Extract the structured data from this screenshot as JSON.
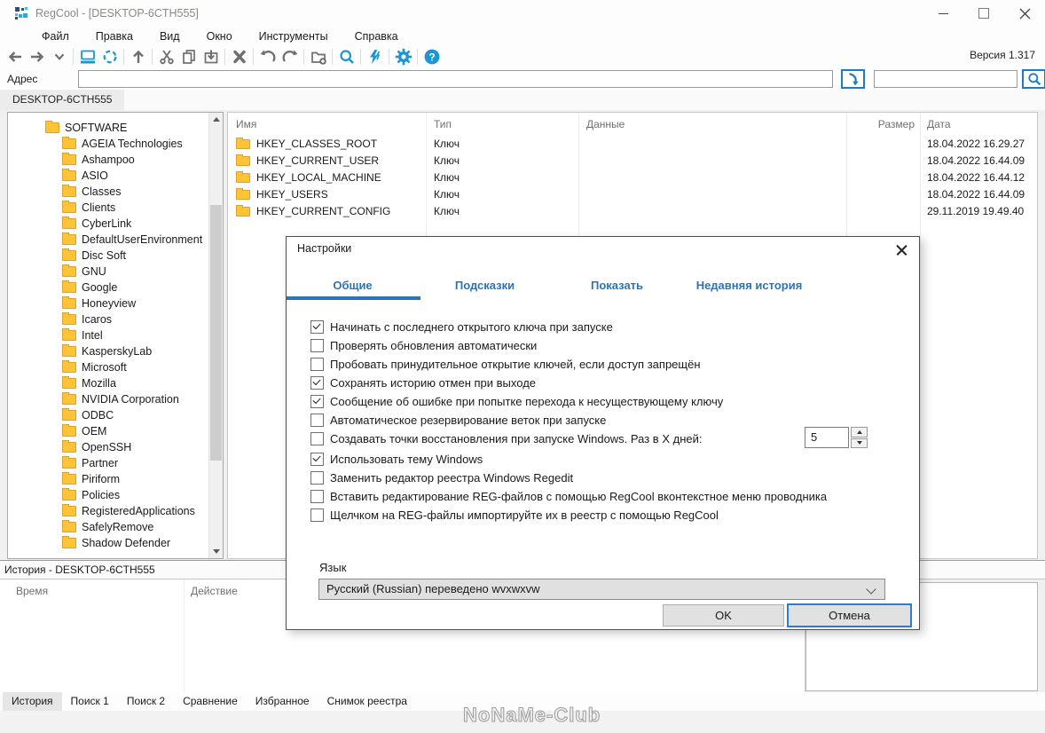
{
  "window": {
    "title": "RegCool - [DESKTOP-6CTH555]",
    "version_label": "Версия 1.317"
  },
  "menu": {
    "items": [
      "Файл",
      "Правка",
      "Вид",
      "Окно",
      "Инструменты",
      "Справка"
    ]
  },
  "toolbar": {
    "icons": [
      "back-arrow",
      "forward-arrow",
      "expand-chevron",
      "computer",
      "refresh",
      "up-level",
      "cut",
      "copy",
      "paste",
      "delete",
      "undo",
      "redo",
      "new-key-folder",
      "search",
      "compare-lightning",
      "settings-gear",
      "help"
    ]
  },
  "address": {
    "label": "Адрес",
    "value": "",
    "search_value": ""
  },
  "session_tab": "DESKTOP-6CTH555",
  "tree": {
    "root": "SOFTWARE",
    "items": [
      "AGEIA Technologies",
      "Ashampoo",
      "ASIO",
      "Classes",
      "Clients",
      "CyberLink",
      "DefaultUserEnvironment",
      "Disc Soft",
      "GNU",
      "Google",
      "Honeyview",
      "Icaros",
      "Intel",
      "KasperskyLab",
      "Microsoft",
      "Mozilla",
      "NVIDIA Corporation",
      "ODBC",
      "OEM",
      "OpenSSH",
      "Partner",
      "Piriform",
      "Policies",
      "RegisteredApplications",
      "SafelyRemove",
      "Shadow Defender"
    ]
  },
  "registry": {
    "columns": {
      "name": "Имя",
      "type": "Тип",
      "data": "Данные",
      "size": "Размер",
      "date": "Дата"
    },
    "rows": [
      {
        "name": "HKEY_CLASSES_ROOT",
        "type": "Ключ",
        "data": "",
        "size": "",
        "date": "18.04.2022 16.29.27"
      },
      {
        "name": "HKEY_CURRENT_USER",
        "type": "Ключ",
        "data": "",
        "size": "",
        "date": "18.04.2022 16.44.09"
      },
      {
        "name": "HKEY_LOCAL_MACHINE",
        "type": "Ключ",
        "data": "",
        "size": "",
        "date": "18.04.2022 16.44.12"
      },
      {
        "name": "HKEY_USERS",
        "type": "Ключ",
        "data": "",
        "size": "",
        "date": "18.04.2022 16.44.09"
      },
      {
        "name": "HKEY_CURRENT_CONFIG",
        "type": "Ключ",
        "data": "",
        "size": "",
        "date": "29.11.2019 19.49.40"
      }
    ]
  },
  "dialog": {
    "title": "Настройки",
    "tabs": [
      {
        "label": "Общие",
        "active": true
      },
      {
        "label": "Подсказки"
      },
      {
        "label": "Показать"
      },
      {
        "label": "Недавняя история"
      }
    ],
    "options_group1": [
      {
        "label": "Начинать с последнего открытого ключа при запуске",
        "checked": true
      },
      {
        "label": "Проверять обновления автоматически",
        "checked": false
      },
      {
        "label": "Пробовать принудительное открытие ключей, если доступ запрещён",
        "checked": false
      },
      {
        "label": "Сохранять историю отмен при выходе",
        "checked": true
      },
      {
        "label": "Сообщение об ошибке при попытке перехода к несуществующему ключу",
        "checked": true
      },
      {
        "label": "Автоматическое резервирование веток при запуске",
        "checked": false
      },
      {
        "label": "Создавать точки восстановления при запуске Windows. Раз в X дней:",
        "checked": false
      }
    ],
    "options_group2": [
      {
        "label": "Использовать тему Windows",
        "checked": true
      },
      {
        "label": "Заменить редактор реестра Windows Regedit",
        "checked": false
      },
      {
        "label": "Вставить редактирование REG-файлов с помощью RegCool вконтекстное меню проводника",
        "checked": false
      },
      {
        "label": "Щелчком на REG-файлы импортируйте их в реестр с помощью RegCool",
        "checked": false
      }
    ],
    "spin_value": "5",
    "language_label": "Язык",
    "language_value": "Русский (Russian) переведено wvxwxvw",
    "ok_label": "OK",
    "cancel_label": "Отмена"
  },
  "history": {
    "title": "История - DESKTOP-6CTH555",
    "columns": [
      "Время",
      "Действие"
    ]
  },
  "bottom_tabs": [
    {
      "label": "История",
      "active": true
    },
    {
      "label": "Поиск 1"
    },
    {
      "label": "Поиск 2"
    },
    {
      "label": "Сравнение"
    },
    {
      "label": "Избранное"
    },
    {
      "label": "Снимок реестра"
    }
  ],
  "watermark": "NoNaMe-Club",
  "colors": {
    "accent_blue": "#1b96d4",
    "tab_blue": "#2e74b5",
    "folder_yellow": "#fdc437"
  }
}
